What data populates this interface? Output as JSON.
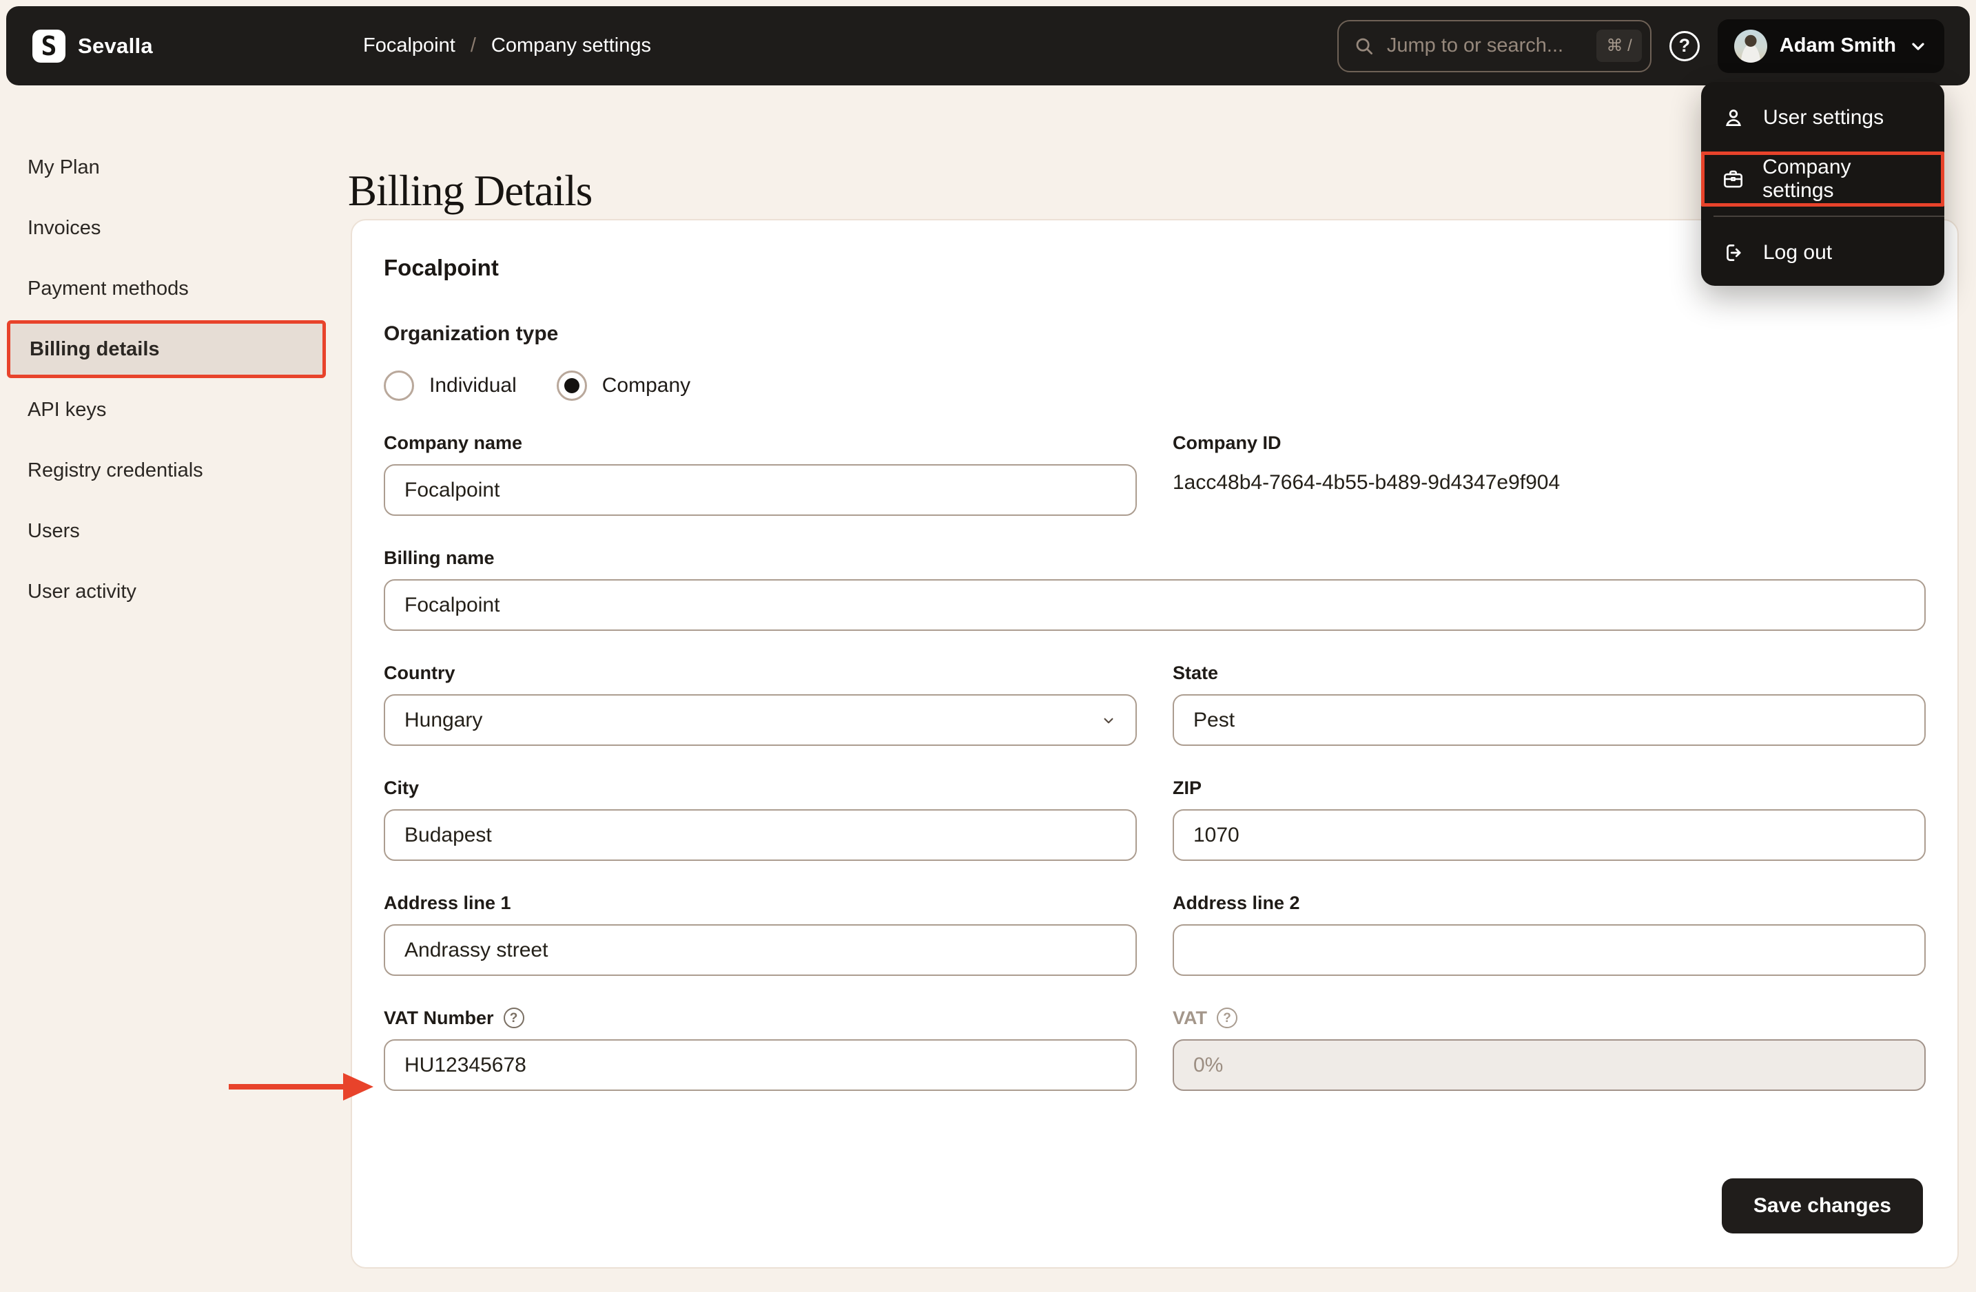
{
  "topbar": {
    "brand": "Sevalla",
    "logo_glyph": "S",
    "breadcrumb": {
      "project": "Focalpoint",
      "separator": "/",
      "section": "Company settings"
    },
    "search": {
      "placeholder": "Jump to or search...",
      "shortcut": "⌘ /"
    },
    "help_glyph": "?",
    "user": {
      "name": "Adam Smith"
    }
  },
  "user_menu": {
    "items": [
      {
        "label": "User settings",
        "icon": "user-icon",
        "highlighted": false
      },
      {
        "label": "Company settings",
        "icon": "briefcase-icon",
        "highlighted": true
      },
      {
        "label": "Log out",
        "icon": "logout-icon",
        "highlighted": false
      }
    ]
  },
  "sidebar": {
    "items": [
      {
        "label": "My Plan",
        "active": false
      },
      {
        "label": "Invoices",
        "active": false
      },
      {
        "label": "Payment methods",
        "active": false
      },
      {
        "label": "Billing details",
        "active": true
      },
      {
        "label": "API keys",
        "active": false
      },
      {
        "label": "Registry credentials",
        "active": false
      },
      {
        "label": "Users",
        "active": false
      },
      {
        "label": "User activity",
        "active": false
      }
    ]
  },
  "page": {
    "title": "Billing Details"
  },
  "form": {
    "card_title": "Focalpoint",
    "organization_type": {
      "label": "Organization type",
      "options": [
        {
          "label": "Individual",
          "selected": false
        },
        {
          "label": "Company",
          "selected": true
        }
      ]
    },
    "fields": {
      "company_name": {
        "label": "Company name",
        "value": "Focalpoint"
      },
      "company_id": {
        "label": "Company ID",
        "value": "1acc48b4-7664-4b55-b489-9d4347e9f904"
      },
      "billing_name": {
        "label": "Billing name",
        "value": "Focalpoint"
      },
      "country": {
        "label": "Country",
        "value": "Hungary"
      },
      "state": {
        "label": "State",
        "value": "Pest"
      },
      "city": {
        "label": "City",
        "value": "Budapest"
      },
      "zip": {
        "label": "ZIP",
        "value": "1070"
      },
      "address1": {
        "label": "Address line 1",
        "value": "Andrassy street"
      },
      "address2": {
        "label": "Address line 2",
        "value": ""
      },
      "vat_number": {
        "label": "VAT Number",
        "value": "HU12345678"
      },
      "vat": {
        "label": "VAT",
        "value": "0%",
        "disabled": true
      }
    },
    "save_label": "Save changes"
  },
  "annotations": {
    "highlight_color": "#e8432b",
    "highlighted_elements": [
      "sidebar-item-billing-details",
      "menu-item-company-settings",
      "vat-number-arrow"
    ]
  },
  "colors": {
    "page_bg": "#f7f1ea",
    "topbar_bg": "#1e1c1a",
    "card_bg": "#ffffff",
    "accent_red": "#e8432b",
    "active_sidebar_bg": "#e6ddd5",
    "input_border": "#ac9d90",
    "save_button_bg": "#201d1b"
  }
}
